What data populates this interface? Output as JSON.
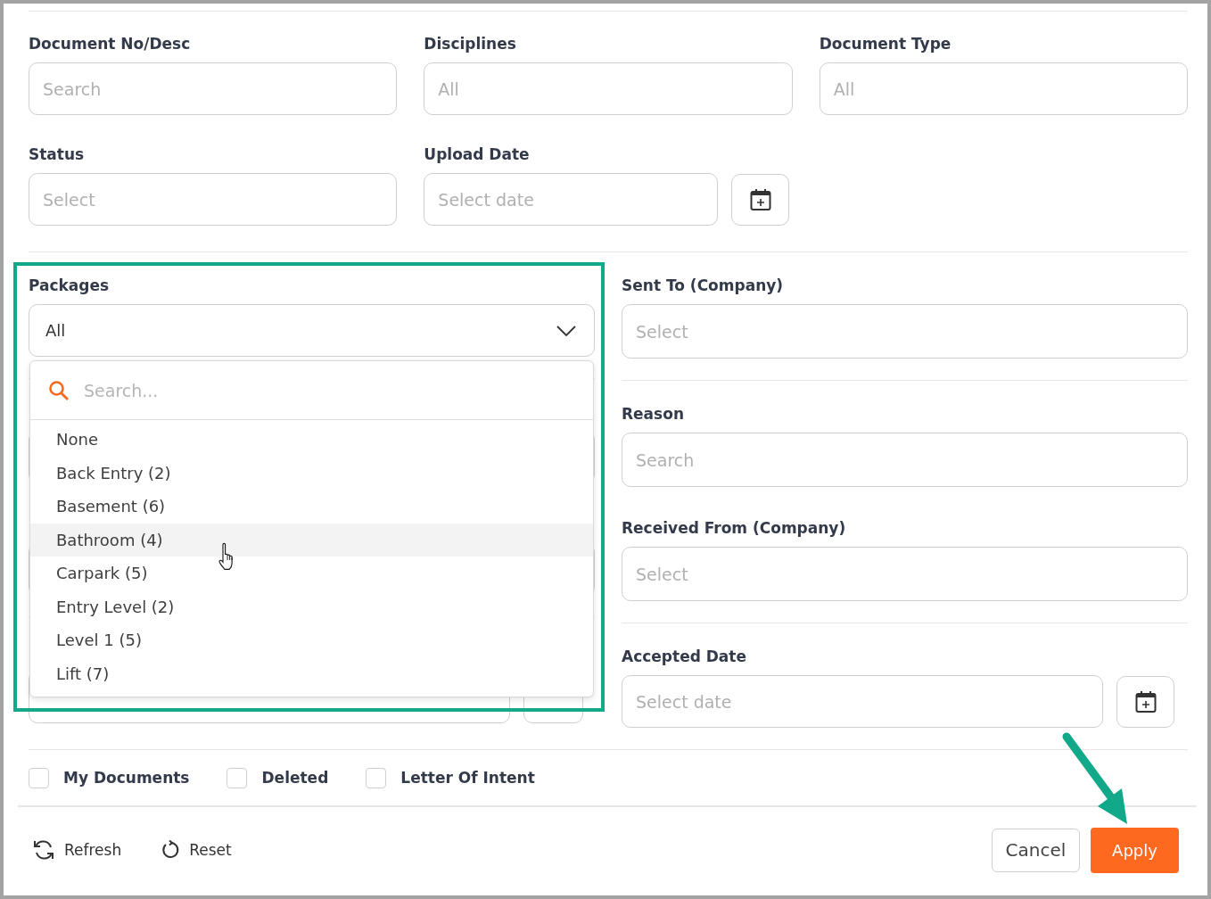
{
  "top_fields": [
    {
      "label": "Document No/Desc",
      "placeholder": "Search"
    },
    {
      "label": "Disciplines",
      "placeholder": "All"
    },
    {
      "label": "Document Type",
      "placeholder": "All"
    }
  ],
  "status": {
    "label": "Status",
    "placeholder": "Select"
  },
  "upload_date": {
    "label": "Upload Date",
    "placeholder": "Select date"
  },
  "packages": {
    "label": "Packages",
    "value": "All",
    "expanded": true,
    "search_placeholder": "Search...",
    "options": [
      {
        "label": "None",
        "highlighted": false
      },
      {
        "label": "Back Entry (2)",
        "highlighted": false
      },
      {
        "label": "Basement (6)",
        "highlighted": false
      },
      {
        "label": "Bathroom (4)",
        "highlighted": true
      },
      {
        "label": "Carpark (5)",
        "highlighted": false
      },
      {
        "label": "Entry Level (2)",
        "highlighted": false
      },
      {
        "label": "Level 1 (5)",
        "highlighted": false
      },
      {
        "label": "Lift (7)",
        "highlighted": false
      }
    ]
  },
  "right_groups": [
    [
      {
        "label": "Sent To (Company)",
        "placeholder": "Select",
        "kind": "text"
      }
    ],
    [
      {
        "label": "Reason",
        "placeholder": "Search",
        "kind": "text"
      },
      {
        "label": "Received From (Company)",
        "placeholder": "Select",
        "kind": "text"
      }
    ],
    [
      {
        "label": "Accepted Date",
        "placeholder": "Select date",
        "kind": "date"
      }
    ]
  ],
  "checkboxes": [
    {
      "label": "My Documents",
      "checked": false
    },
    {
      "label": "Deleted",
      "checked": false
    },
    {
      "label": "Letter Of Intent",
      "checked": false
    }
  ],
  "footer": {
    "refresh": "Refresh",
    "reset": "Reset",
    "cancel": "Cancel",
    "apply": "Apply"
  }
}
